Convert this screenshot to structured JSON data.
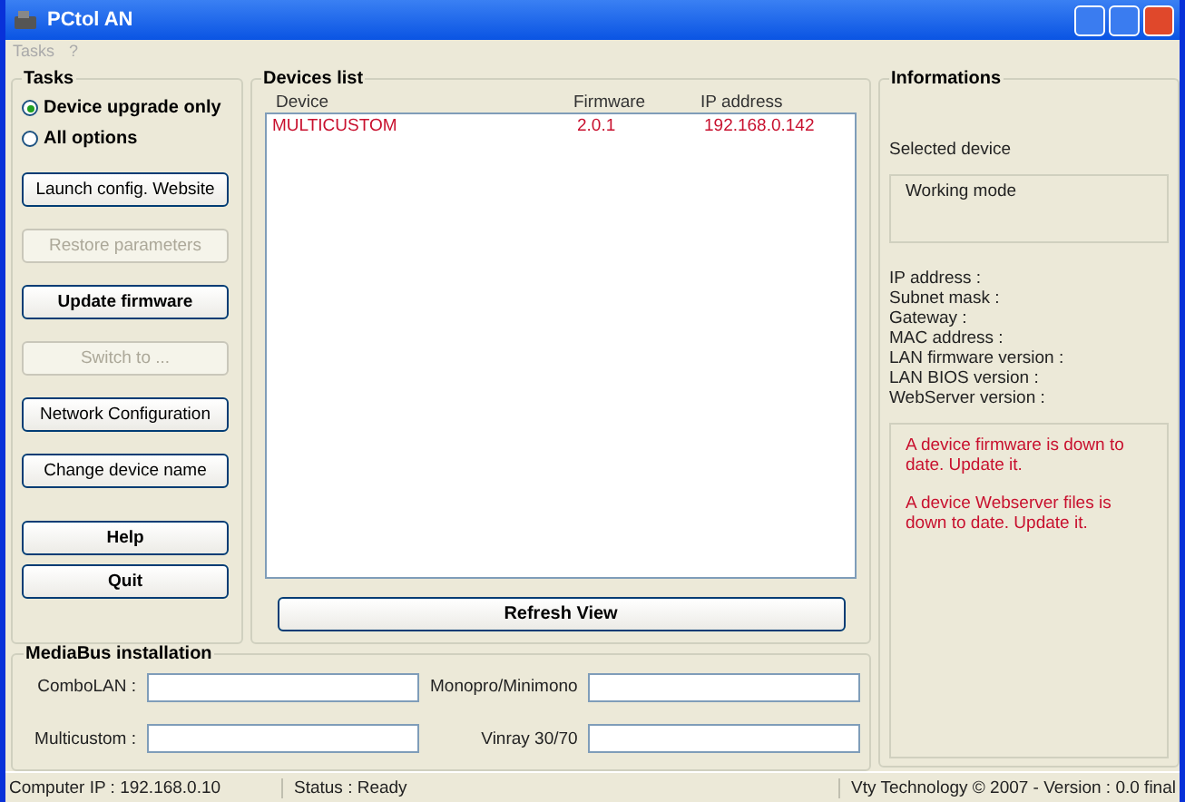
{
  "window": {
    "title": "PCtol AN"
  },
  "menu": [
    "Tasks",
    "?"
  ],
  "tasks": {
    "title": "Tasks",
    "options": [
      {
        "label": "Device upgrade only",
        "selected": true
      },
      {
        "label": "All options",
        "selected": false
      }
    ],
    "buttons": [
      {
        "label": "Launch config. Website",
        "disabled": false,
        "bold": false
      },
      {
        "label": "Restore parameters",
        "disabled": true,
        "bold": false
      },
      {
        "label": "Update firmware",
        "disabled": false,
        "bold": true
      },
      {
        "label": "Switch to ...",
        "disabled": true,
        "bold": false
      },
      {
        "label": "Network Configuration",
        "disabled": false,
        "bold": false
      },
      {
        "label": "Change device name",
        "disabled": false,
        "bold": false
      }
    ],
    "bottom_buttons": [
      {
        "label": "Help",
        "disabled": false,
        "bold": true
      },
      {
        "label": "Quit",
        "disabled": false,
        "bold": true
      }
    ]
  },
  "devices": {
    "title": "Devices list",
    "columns": [
      "Device",
      "Firmware",
      "IP address"
    ],
    "rows": [
      {
        "device": "MULTICUSTOM",
        "firmware": "2.0.1",
        "ip": "192.168.0.142"
      }
    ],
    "refresh_button": "Refresh View"
  },
  "info": {
    "title": "Informations",
    "selected_device": "Selected device",
    "working_mode": "Working mode",
    "fields": [
      "IP address :",
      "Subnet mask :",
      "Gateway :",
      "MAC address :",
      "LAN firmware version :",
      "LAN BIOS version :",
      "WebServer version :"
    ],
    "messages": [
      "A device firmware is down to date. Update it.",
      "A device Webserver files is down to date. Update it."
    ]
  },
  "mediabus": {
    "title": "MediaBus installation",
    "fields": [
      {
        "label": "ComboLAN :"
      },
      {
        "label": "Monopro/Minimono"
      },
      {
        "label": "Multicustom :"
      },
      {
        "label": "Vinray 30/70"
      }
    ]
  },
  "status_bar": {
    "computer_ip": "Computer IP : 192.168.0.10",
    "status": "Status : Ready",
    "copyright": "Vty Technology © 2007 - Version : 0.0 final"
  }
}
